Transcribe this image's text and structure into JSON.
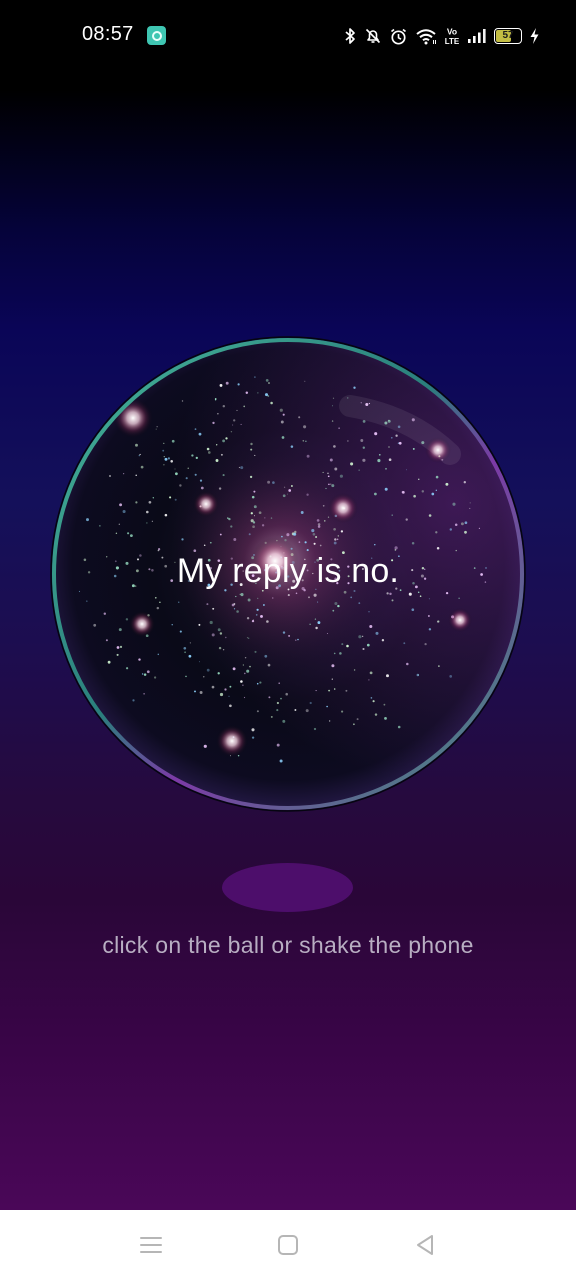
{
  "status_bar": {
    "time": "08:57",
    "notification_icon": "app-notification-icon",
    "icons": [
      "bluetooth-icon",
      "bell-off-icon",
      "alarm-icon",
      "wifi-icon",
      "volte-icon",
      "signal-icon",
      "battery-icon",
      "charging-icon"
    ],
    "volte_label_top": "Vo",
    "volte_label_bottom": "LTE",
    "battery_level": "57"
  },
  "ball": {
    "answer": "My reply is no."
  },
  "hint": "click on the ball or shake the phone",
  "nav_bar": {
    "icons": [
      "menu-icon",
      "home-icon",
      "back-icon"
    ]
  },
  "colors": {
    "accent_purple": "#4d0e6b",
    "hint_text": "#b8aec2",
    "ball_rim": "#3aa58a"
  }
}
